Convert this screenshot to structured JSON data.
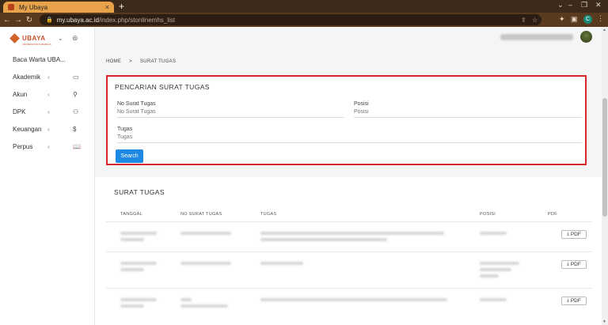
{
  "browser": {
    "tab_title": "My Ubaya",
    "url_host": "my.ubaya.ac.id",
    "url_path": "/index.php/stonlinemhs_list"
  },
  "sidebar": {
    "logo": "UBAYA",
    "logo_sub": "UNIVERSITAS SURABAYA",
    "items": [
      {
        "label": "Baca Warta UBA...",
        "icon": "none"
      },
      {
        "label": "Akademik",
        "icon": "book-icon"
      },
      {
        "label": "Akun",
        "icon": "user-icon"
      },
      {
        "label": "DPK",
        "icon": "badge-icon"
      },
      {
        "label": "Keuangan",
        "icon": "dollar-icon"
      },
      {
        "label": "Perpus",
        "icon": "open-book-icon"
      }
    ]
  },
  "breadcrumb": {
    "home": "HOME",
    "separator": ">",
    "current": "SURAT TUGAS"
  },
  "search": {
    "title": "PENCARIAN SURAT TUGAS",
    "no_surat_label": "No Surat Tugas",
    "no_surat_placeholder": "No Surat Tugas",
    "posisi_label": "Posisi",
    "posisi_placeholder": "Posisi",
    "tugas_label": "Tugas",
    "tugas_placeholder": "Tugas",
    "button": "Search"
  },
  "list": {
    "title": "SURAT TUGAS",
    "columns": [
      "TANGGAL",
      "NO SURAT TUGAS",
      "TUGAS",
      "POSISI",
      "PDF"
    ],
    "pdf_label": "PDF"
  },
  "colors": {
    "highlight": "#d9262e",
    "primary": "#1e88e5",
    "brand": "#c8502a"
  }
}
